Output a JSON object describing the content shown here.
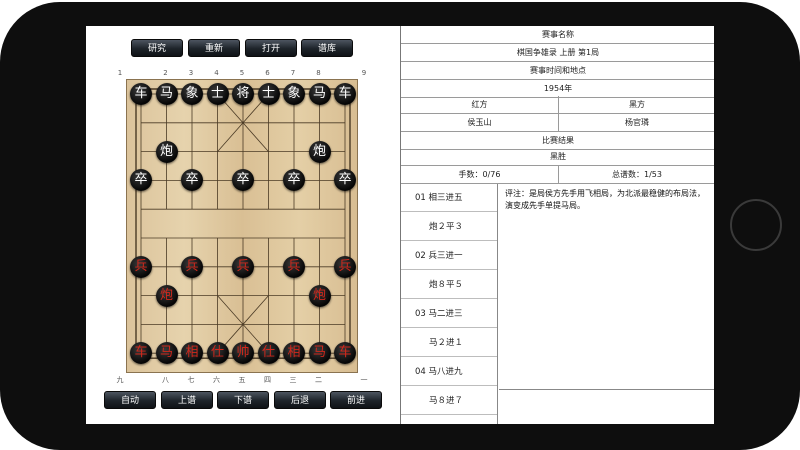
{
  "toolbar_top": [
    "研究",
    "重新",
    "打开",
    "谱库"
  ],
  "toolbar_bottom": [
    "自动",
    "上谱",
    "下谱",
    "后退",
    "前进"
  ],
  "top_numbers": [
    "1",
    "2",
    "3",
    "4",
    "5",
    "6",
    "7",
    "8",
    "9"
  ],
  "bottom_numbers": [
    "九",
    "八",
    "七",
    "六",
    "五",
    "四",
    "三",
    "二",
    "一"
  ],
  "pieces": [
    {
      "c": "车",
      "s": "black",
      "f": 1,
      "r": 0
    },
    {
      "c": "马",
      "s": "black",
      "f": 2,
      "r": 0
    },
    {
      "c": "象",
      "s": "black",
      "f": 3,
      "r": 0
    },
    {
      "c": "士",
      "s": "black",
      "f": 4,
      "r": 0
    },
    {
      "c": "将",
      "s": "black",
      "f": 5,
      "r": 0
    },
    {
      "c": "士",
      "s": "black",
      "f": 6,
      "r": 0
    },
    {
      "c": "象",
      "s": "black",
      "f": 7,
      "r": 0
    },
    {
      "c": "马",
      "s": "black",
      "f": 8,
      "r": 0
    },
    {
      "c": "车",
      "s": "black",
      "f": 9,
      "r": 0
    },
    {
      "c": "炮",
      "s": "black",
      "f": 2,
      "r": 2
    },
    {
      "c": "炮",
      "s": "black",
      "f": 8,
      "r": 2
    },
    {
      "c": "卒",
      "s": "black",
      "f": 1,
      "r": 3
    },
    {
      "c": "卒",
      "s": "black",
      "f": 3,
      "r": 3
    },
    {
      "c": "卒",
      "s": "black",
      "f": 5,
      "r": 3
    },
    {
      "c": "卒",
      "s": "black",
      "f": 7,
      "r": 3
    },
    {
      "c": "卒",
      "s": "black",
      "f": 9,
      "r": 3
    },
    {
      "c": "兵",
      "s": "red",
      "f": 1,
      "r": 6
    },
    {
      "c": "兵",
      "s": "red",
      "f": 3,
      "r": 6
    },
    {
      "c": "兵",
      "s": "red",
      "f": 5,
      "r": 6
    },
    {
      "c": "兵",
      "s": "red",
      "f": 7,
      "r": 6
    },
    {
      "c": "兵",
      "s": "red",
      "f": 9,
      "r": 6
    },
    {
      "c": "炮",
      "s": "red",
      "f": 2,
      "r": 7
    },
    {
      "c": "炮",
      "s": "red",
      "f": 8,
      "r": 7
    },
    {
      "c": "车",
      "s": "red",
      "f": 1,
      "r": 9
    },
    {
      "c": "马",
      "s": "red",
      "f": 2,
      "r": 9
    },
    {
      "c": "相",
      "s": "red",
      "f": 3,
      "r": 9
    },
    {
      "c": "仕",
      "s": "red",
      "f": 4,
      "r": 9
    },
    {
      "c": "帅",
      "s": "red",
      "f": 5,
      "r": 9
    },
    {
      "c": "仕",
      "s": "red",
      "f": 6,
      "r": 9
    },
    {
      "c": "相",
      "s": "red",
      "f": 7,
      "r": 9
    },
    {
      "c": "马",
      "s": "red",
      "f": 8,
      "r": 9
    },
    {
      "c": "车",
      "s": "red",
      "f": 9,
      "r": 9
    }
  ],
  "info": {
    "event_label": "赛事名称",
    "event": "棋国争雄录 上册 第1局",
    "time_place_label": "赛事时间和地点",
    "time_place": "1954年",
    "red_label": "红方",
    "black_label": "黑方",
    "red_player": "侯玉山",
    "black_player": "杨官璘",
    "result_label": "比赛结果",
    "result": "黑胜",
    "moves_count": "手数：0/76",
    "total": "总谱数：1/53"
  },
  "moves": [
    "01  相三进五",
    "炮２平３",
    "02  兵三进一",
    "炮８平５",
    "03  马二进三",
    "马２进１",
    "04  马八进九",
    "马８进７"
  ],
  "comment": "评注：是局侯方先手用飞相局，为北派最稳健的布局法，演变成先手单提马局。",
  "colors": {
    "red_piece": "#d0281c",
    "black_piece": "#ffffff",
    "board": "#dcc49c"
  }
}
